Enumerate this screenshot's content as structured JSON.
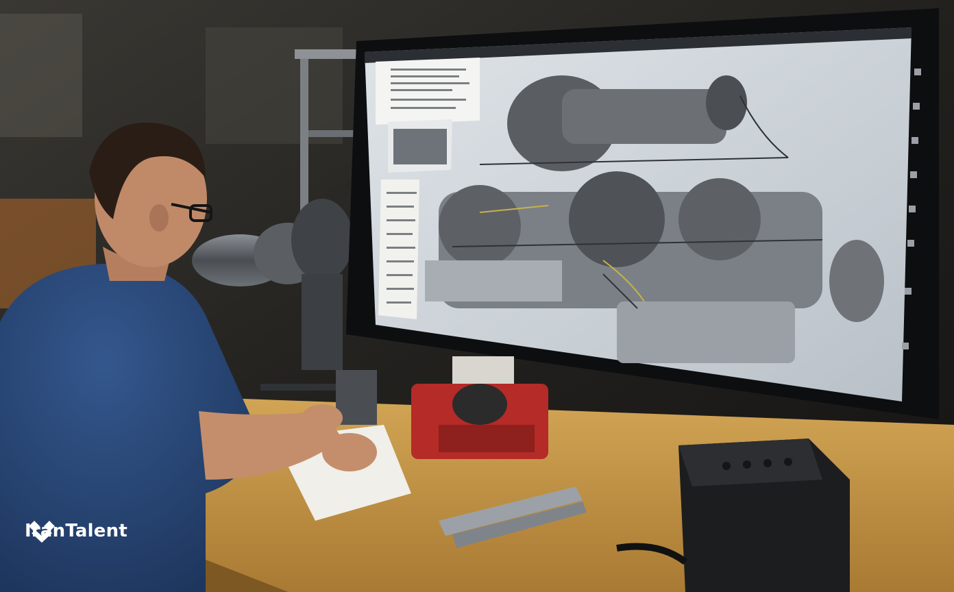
{
  "watermark": {
    "brand": "IranTalent",
    "logo_icon": "hearts-mark-icon",
    "color": "#ffffff"
  },
  "colors": {
    "wall": "#2a2825",
    "desk": "#c99a4a",
    "shirt": "#2b4a7a",
    "screen_bg": "#cfd6dc",
    "machine_red": "#c9302c"
  }
}
